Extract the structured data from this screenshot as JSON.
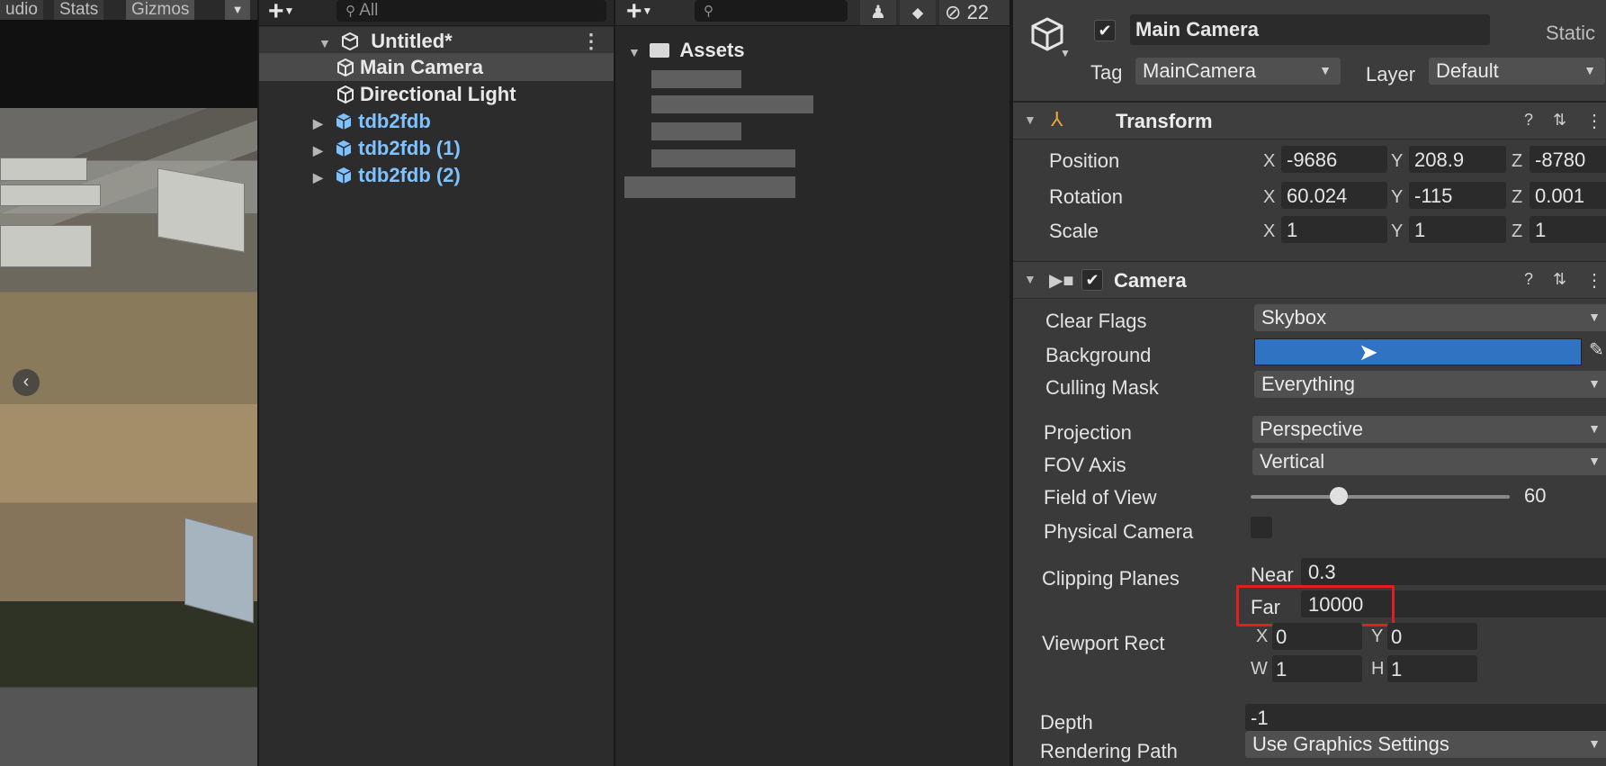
{
  "scene": {
    "tabs": [
      "udio",
      "Stats",
      "Gizmos"
    ]
  },
  "hierarchy": {
    "search_placeholder": "All",
    "scene_name": "Untitled*",
    "items": [
      {
        "label": "Main Camera"
      },
      {
        "label": "Directional Light"
      },
      {
        "label": "tdb2fdb"
      },
      {
        "label": "tdb2fdb (1)"
      },
      {
        "label": "tdb2fdb (2)"
      }
    ]
  },
  "project": {
    "root": "Assets",
    "hidden_count": "22"
  },
  "inspector": {
    "object_name": "Main Camera",
    "static_label": "Static",
    "tag_label": "Tag",
    "tag_value": "MainCamera",
    "layer_label": "Layer",
    "layer_value": "Default",
    "transform": {
      "title": "Transform",
      "position_label": "Position",
      "rotation_label": "Rotation",
      "scale_label": "Scale",
      "position": {
        "x": "-9686",
        "y": "208.9",
        "z": "-8780"
      },
      "rotation": {
        "x": "60.024",
        "y": "-115",
        "z": "0.001"
      },
      "scale": {
        "x": "1",
        "y": "1",
        "z": "1"
      }
    },
    "camera": {
      "title": "Camera",
      "clear_flags_label": "Clear Flags",
      "clear_flags_value": "Skybox",
      "background_label": "Background",
      "background_color": "#2f73c2",
      "culling_mask_label": "Culling Mask",
      "culling_mask_value": "Everything",
      "projection_label": "Projection",
      "projection_value": "Perspective",
      "fov_axis_label": "FOV Axis",
      "fov_axis_value": "Vertical",
      "fov_label": "Field of View",
      "fov_value": "60",
      "physical_camera_label": "Physical Camera",
      "clipping_label": "Clipping Planes",
      "near_label": "Near",
      "near_value": "0.3",
      "far_label": "Far",
      "far_value": "10000",
      "viewport_label": "Viewport Rect",
      "viewport": {
        "x": "0",
        "y": "0",
        "w": "1",
        "h": "1"
      },
      "depth_label": "Depth",
      "depth_value": "-1",
      "rendering_path_label": "Rendering Path",
      "rendering_path_value": "Use Graphics Settings"
    }
  },
  "colors": {
    "highlight_box": "#e02020",
    "prefab_text": "#7ec2ff"
  }
}
